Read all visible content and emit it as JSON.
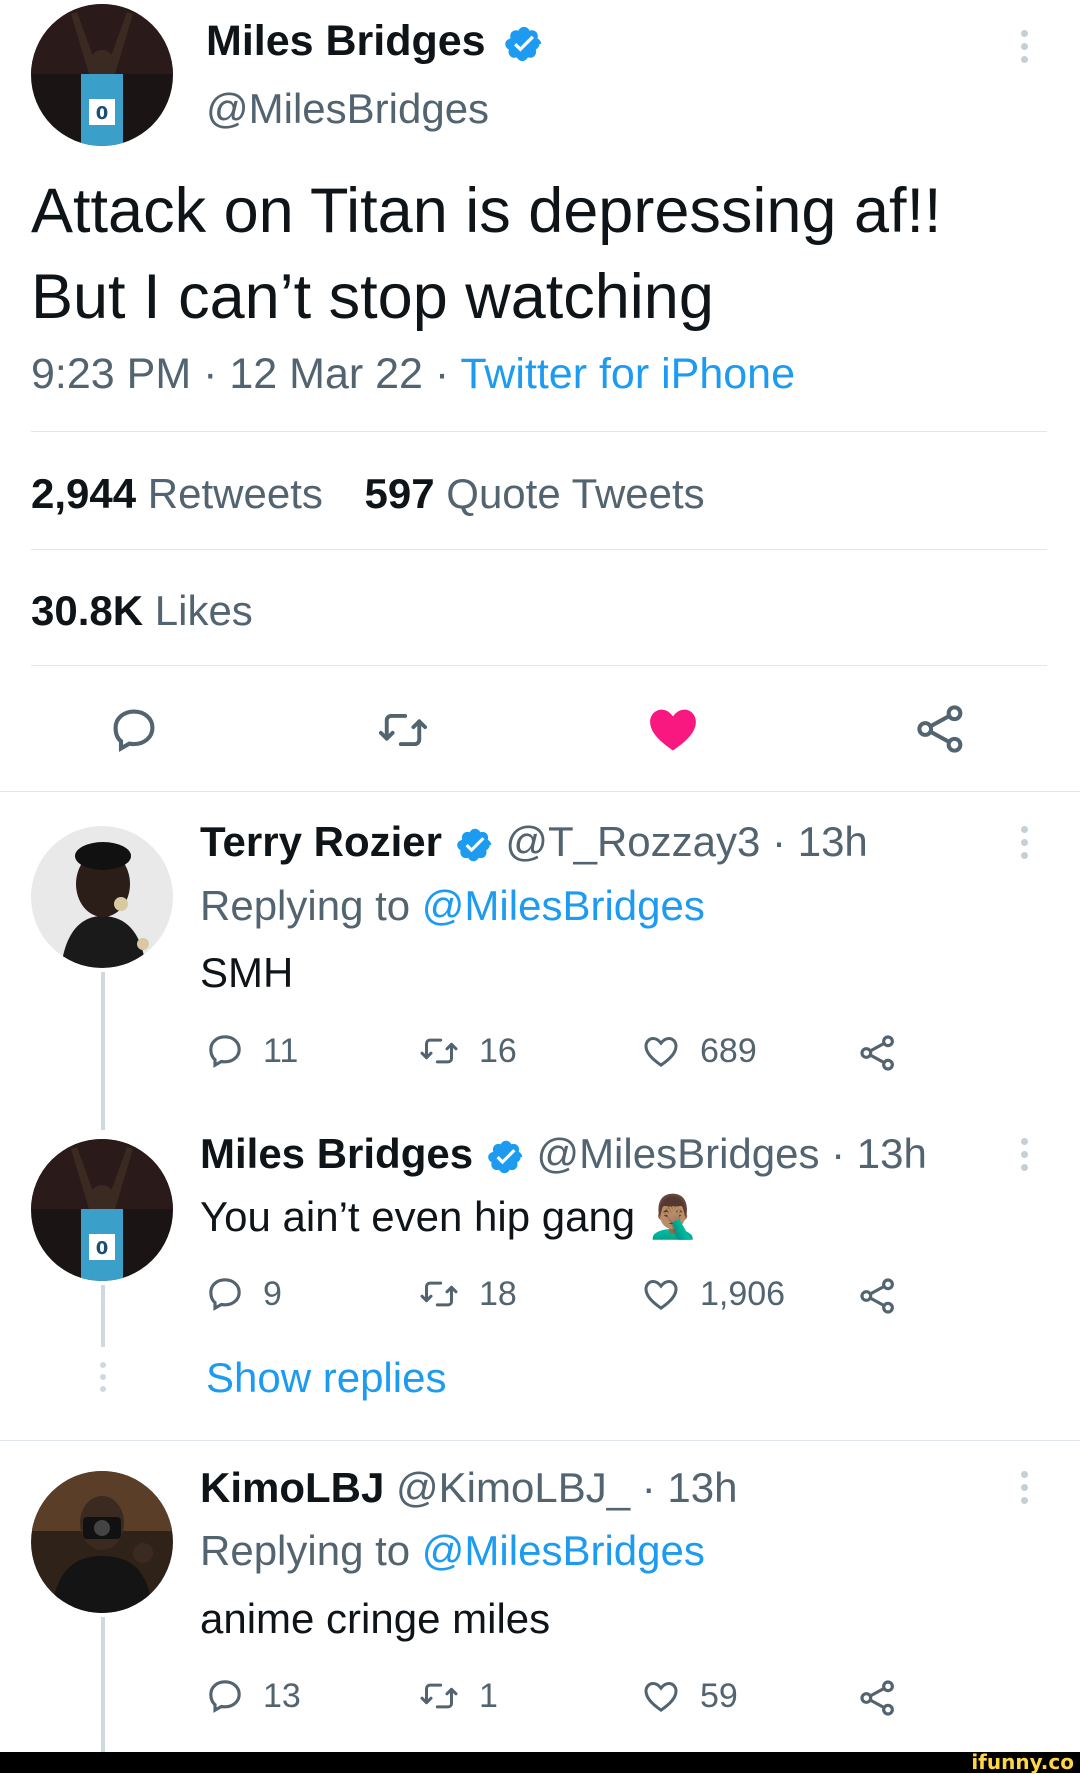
{
  "main_tweet": {
    "author_name": "Miles Bridges",
    "handle": "@MilesBridges",
    "text_line1": "Attack on Titan is depressing af!!",
    "text_line2": "But I can’t stop watching",
    "time": "9:23 PM · 12 Mar 22 · ",
    "source": "Twitter for iPhone",
    "retweets_count": "2,944",
    "retweets_label": "Retweets",
    "quotes_count": "597",
    "quotes_label": "Quote Tweets",
    "likes_count": "30.8K",
    "likes_label": "Likes",
    "liked": true
  },
  "replies": [
    {
      "author_name": "Terry Rozier",
      "verified": true,
      "meta": "@T_Rozzay3 · 13h",
      "replying_prefix": "Replying to ",
      "replying_handle": "@MilesBridges",
      "text": "SMH",
      "reply_count": "11",
      "retweet_count": "16",
      "like_count": "689"
    },
    {
      "author_name": "Miles Bridges",
      "verified": true,
      "meta": "@MilesBridges · 13h",
      "text": "You ain’t even hip gang 🤦🏽‍♂️",
      "reply_count": "9",
      "retweet_count": "18",
      "like_count": "1,906",
      "show_replies": "Show replies"
    },
    {
      "author_name": "KimoLBJ",
      "verified": false,
      "meta": "@KimoLBJ_ · 13h",
      "replying_prefix": "Replying to ",
      "replying_handle": "@MilesBridges",
      "text": "anime cringe miles",
      "reply_count": "13",
      "retweet_count": "1",
      "like_count": "59"
    }
  ],
  "watermark": "ifunny.co",
  "colors": {
    "accent": "#1d9bf0",
    "like": "#f91880",
    "secondary": "#536471"
  }
}
